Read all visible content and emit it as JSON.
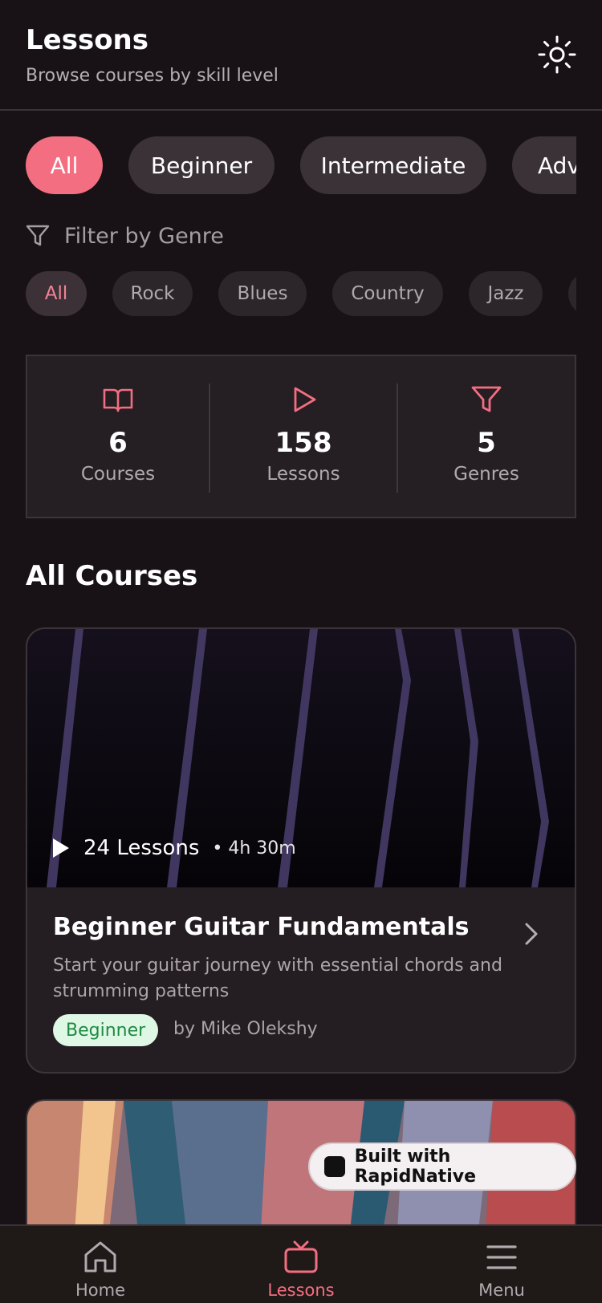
{
  "header": {
    "title": "Lessons",
    "subtitle": "Browse courses by skill level"
  },
  "level_filters": [
    {
      "label": "All",
      "active": true
    },
    {
      "label": "Beginner",
      "active": false
    },
    {
      "label": "Intermediate",
      "active": false
    },
    {
      "label": "Adv",
      "active": false
    }
  ],
  "genre_filter": {
    "label": "Filter by Genre",
    "genres": [
      {
        "label": "All",
        "active": true
      },
      {
        "label": "Rock",
        "active": false
      },
      {
        "label": "Blues",
        "active": false
      },
      {
        "label": "Country",
        "active": false
      },
      {
        "label": "Jazz",
        "active": false
      }
    ]
  },
  "stats": [
    {
      "value": "6",
      "label": "Courses",
      "icon": "book-icon"
    },
    {
      "value": "158",
      "label": "Lessons",
      "icon": "play-icon"
    },
    {
      "value": "5",
      "label": "Genres",
      "icon": "filter-icon"
    }
  ],
  "section_title": "All Courses",
  "courses": [
    {
      "lessons": "24 Lessons",
      "duration": "• 4h 30m",
      "title": "Beginner Guitar Fundamentals",
      "description": "Start your guitar journey with essential chords and strumming patterns",
      "level": "Beginner",
      "author": "by Mike Olekshy"
    }
  ],
  "badge": {
    "label": "Built with RapidNative"
  },
  "tabs": [
    {
      "label": "Home",
      "icon": "home-icon",
      "active": false
    },
    {
      "label": "Lessons",
      "icon": "tv-icon",
      "active": true
    },
    {
      "label": "Menu",
      "icon": "menu-icon",
      "active": false
    }
  ],
  "colors": {
    "accent": "#f46e82",
    "background": "#181216",
    "card": "#241d21",
    "beginner_badge_bg": "#dff8e6",
    "beginner_badge_text": "#1f8a42"
  }
}
